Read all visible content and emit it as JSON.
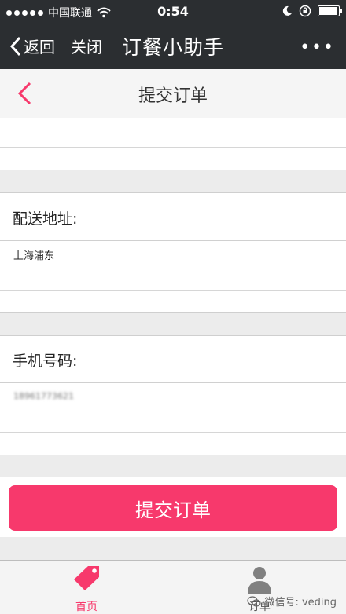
{
  "status_bar": {
    "carrier": "中国联通",
    "time": "0:54"
  },
  "wechat_header": {
    "back_label": "返回",
    "close_label": "关闭",
    "title": "订餐小助手",
    "more_label": "•••"
  },
  "page": {
    "title": "提交订单"
  },
  "form": {
    "address_label": "配送地址:",
    "address_value": "上海浦东",
    "phone_label": "手机号码:",
    "phone_value": "18961773621"
  },
  "submit_label": "提交订单",
  "tabbar": {
    "home_label": "首页",
    "order_label": "订单",
    "watermark": "微信号: veding"
  },
  "colors": {
    "accent": "#f7396c",
    "header_bg": "#2b2e31"
  }
}
